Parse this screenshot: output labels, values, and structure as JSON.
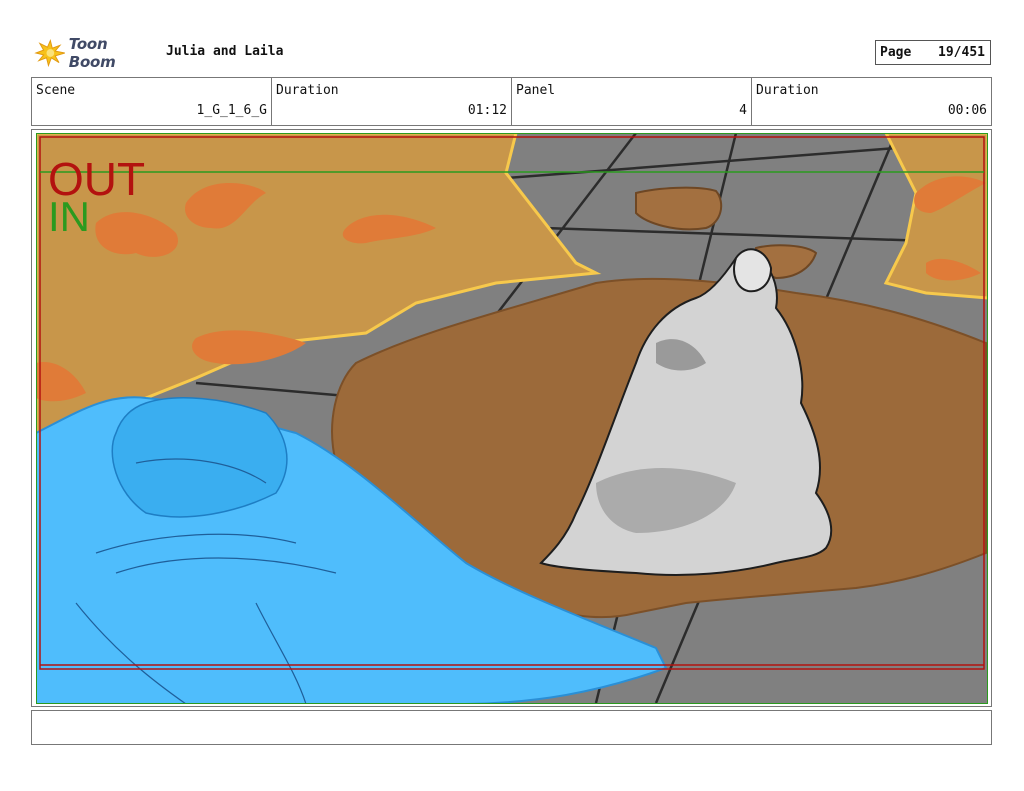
{
  "header": {
    "logo_text": "Toon Boom",
    "project_title": "Julia and Laila",
    "page_label": "Page",
    "page_value": "19/451"
  },
  "info": {
    "scene_label": "Scene",
    "scene_value": "1_G_1_6_G",
    "scene_duration_label": "Duration",
    "scene_duration_value": "01:12",
    "panel_label": "Panel",
    "panel_value": "4",
    "panel_duration_label": "Duration",
    "panel_duration_value": "00:06"
  },
  "panel": {
    "out_label": "OUT",
    "in_label": "IN"
  },
  "colors": {
    "out_color": "#b3120f",
    "in_color": "#2b9a1f",
    "sand": "#c8964a",
    "floor": "#808080",
    "crater": "#9c6a3a",
    "blue_figure": "#4fbdfc",
    "cloak": "#d3d3d3"
  }
}
